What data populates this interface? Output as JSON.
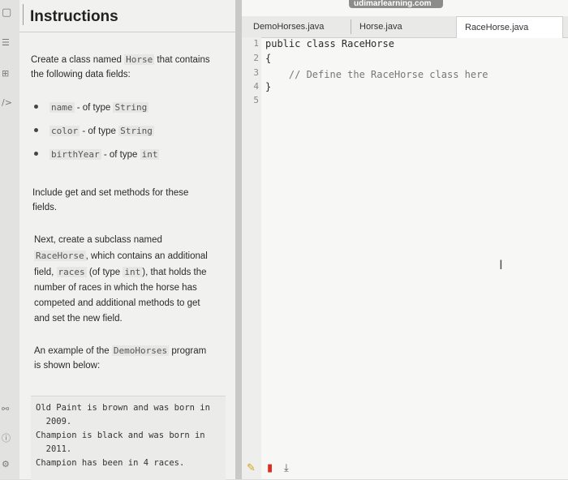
{
  "watermark": "udimarlearning.com",
  "instructions": {
    "title": "Instructions",
    "intro_pre": "Create a class named",
    "intro_class": "Horse",
    "intro_post": "that contains",
    "intro_line2": "the following data fields:",
    "fields": [
      {
        "name": "name",
        "text": "- of type",
        "type": "String"
      },
      {
        "name": "color",
        "text": "- of type",
        "type": "String"
      },
      {
        "name": "birthYear",
        "text": "- of type",
        "type": "int"
      }
    ],
    "get_set_1": "Include get and set methods for these",
    "get_set_2": "fields.",
    "sub_1": "Next, create a subclass named",
    "sub_2_class": "RaceHorse",
    "sub_2_post": ", which contains an additional",
    "sub_3_pre": "field,",
    "sub_3_field": "races",
    "sub_3_mid": "(of type",
    "sub_3_type": "int",
    "sub_3_post": "), that holds the",
    "sub_4": "number of races in which the horse has",
    "sub_5": "competed and additional methods to get",
    "sub_6": "and set the new field.",
    "example_pre": "An example of the",
    "example_code": "DemoHorses",
    "example_post": "program",
    "example_2": "is shown below:",
    "output": [
      "Old Paint is brown and was born in",
      "  2009.",
      "Champion is black and was born in",
      "  2011.",
      "Champion has been in 4 races."
    ]
  },
  "editor": {
    "tabs": [
      "DemoHorses.java",
      "Horse.java",
      "RaceHorse.java"
    ],
    "active_tab": "RaceHorse.java",
    "line_numbers": [
      "1",
      "2",
      "3",
      "4",
      "5"
    ],
    "lines": [
      "public class RaceHorse",
      "{",
      "    // Define the RaceHorse class here",
      "}",
      ""
    ]
  },
  "icons": {
    "rail": [
      "square-icon",
      "menu-icon",
      "code-icon",
      "share-icon",
      "help-icon",
      "settings-icon"
    ],
    "tools": [
      "pencil-icon",
      "trash-icon",
      "download-icon"
    ],
    "tool_colors": {
      "pencil": "#d4a017",
      "trash": "#d93025",
      "download": "#555555"
    }
  }
}
